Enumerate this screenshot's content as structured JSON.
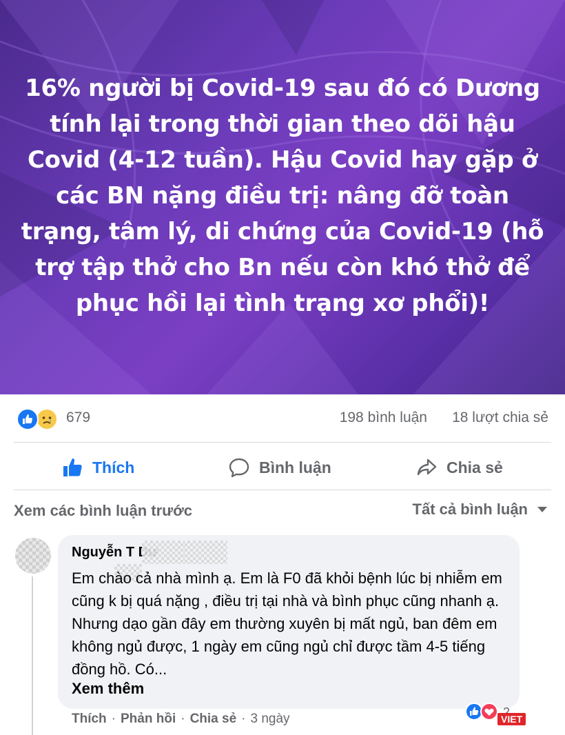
{
  "post": {
    "text": "16% người bị Covid-19 sau đó có Dương tính lại trong thời gian theo dõi hậu Covid (4-12 tuần). Hậu Covid hay gặp ở các BN nặng điều trị: nâng đỡ toàn trạng, tâm lý, di chứng của Covid-19 (hỗ trợ tập thở cho Bn nếu còn khó thở để phục hồi lại tình trạng xơ phổi)!",
    "background_colors": [
      "#4a2a8c",
      "#7b3fc4",
      "#3f2480"
    ]
  },
  "stats": {
    "reactions": [
      "like-icon",
      "sad-icon"
    ],
    "reaction_count": "679",
    "comments": "198 bình luận",
    "shares": "18 lượt chia sẻ"
  },
  "actions": {
    "like": "Thích",
    "comment": "Bình luận",
    "share": "Chia sẻ",
    "accent_color": "#1877f2"
  },
  "comments_header": {
    "previous": "Xem các bình luận trước",
    "filter": "Tất cả bình luận"
  },
  "comment": {
    "author": "Nguyễn T    Dư",
    "text": "Em chào cả nhà mình ạ. Em là F0 đã khỏi bệnh lúc bị nhiễm em cũng k bị quá nặng , điều trị tại nhà và bình phục cũng nhanh ạ. Nhưng dạo gần đây em thường xuyên bị mất ngủ, ban đêm em không ngủ được, 1 ngày em cũng ngủ chỉ được tầm 4-5 tiếng đồng hồ. Có...",
    "see_more": "Xem thêm",
    "like": "Thích",
    "reply": "Phản hồi",
    "share": "Chia sẻ",
    "time": "3 ngày",
    "separator": "·",
    "reaction_count": "2"
  },
  "watermark": "VIET"
}
